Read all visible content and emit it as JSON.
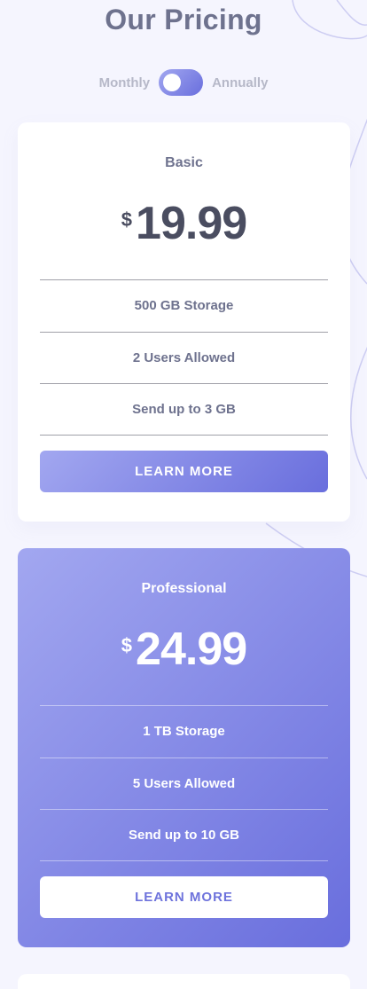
{
  "page": {
    "title": "Our Pricing"
  },
  "billing_toggle": {
    "left_label": "Monthly",
    "right_label": "Annually",
    "selected": "Monthly"
  },
  "plans": [
    {
      "name": "Basic",
      "currency": "$",
      "price": "19.99",
      "features": [
        "500 GB Storage",
        "2 Users Allowed",
        "Send up to 3 GB"
      ],
      "cta_label": "LEARN MORE"
    },
    {
      "name": "Professional",
      "currency": "$",
      "price": "24.99",
      "features": [
        "1 TB Storage",
        "5 Users Allowed",
        "Send up to 10 GB"
      ],
      "cta_label": "LEARN MORE"
    }
  ],
  "colors": {
    "background": "#f5f5fe",
    "gradient_start": "#a2a7f0",
    "gradient_end": "#696edd",
    "text_muted": "#6e728e",
    "price_dark": "#4a4d60"
  }
}
